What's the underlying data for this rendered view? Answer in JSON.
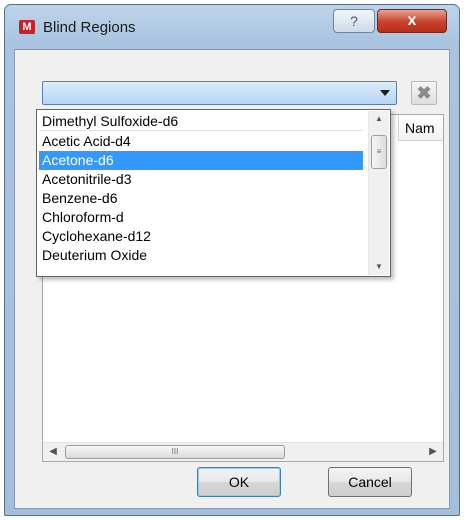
{
  "window": {
    "title": "Blind Regions",
    "app_icon": "M",
    "help_glyph": "?",
    "close_glyph": "x"
  },
  "toolbar": {
    "combo_value": "",
    "delete_glyph": "✖"
  },
  "table": {
    "column_header": "Nam"
  },
  "dropdown": {
    "items": [
      "Dimethyl Sulfoxide-d6",
      "Acetic Acid-d4",
      "Acetone-d6",
      "Acetonitrile-d3",
      "Benzene-d6",
      "Chloroform-d",
      "Cyclohexane-d12",
      "Deuterium Oxide"
    ],
    "selected_index": 2
  },
  "scrollbar": {
    "grip_glyph": "III",
    "left_arrow": "◀",
    "right_arrow": "▶",
    "up_arrow": "▲",
    "down_arrow": "▼"
  },
  "buttons": {
    "ok_label": "OK",
    "cancel_label": "Cancel"
  }
}
